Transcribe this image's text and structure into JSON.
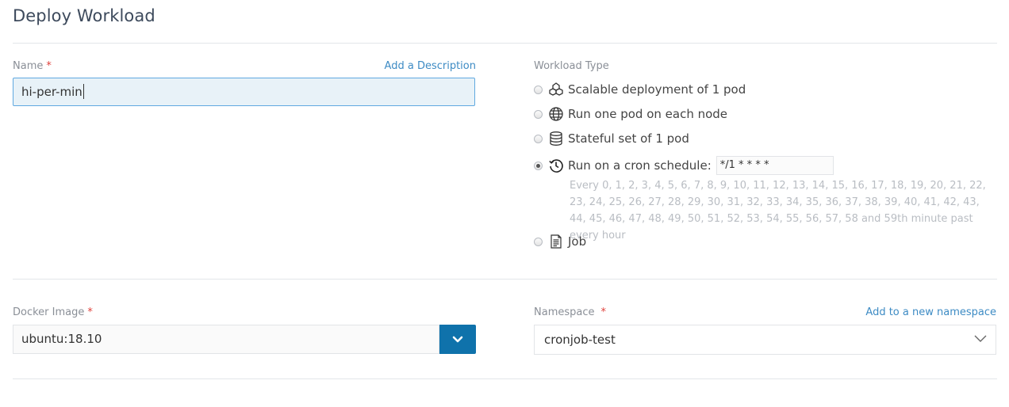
{
  "page": {
    "title": "Deploy Workload"
  },
  "name_field": {
    "label": "Name",
    "required_mark": "*",
    "value": "hi-per-min",
    "add_description_link": "Add a Description"
  },
  "workload_type": {
    "label": "Workload Type",
    "options": [
      {
        "label": "Scalable deployment of 1 pod",
        "icon": "scalable-deployment-icon",
        "selected": false
      },
      {
        "label": "Run one pod on each node",
        "icon": "globe-icon",
        "selected": false
      },
      {
        "label": "Stateful set of 1 pod",
        "icon": "database-icon",
        "selected": false
      },
      {
        "label": "Run on a cron schedule:",
        "icon": "clock-history-icon",
        "selected": true
      },
      {
        "label": "Job",
        "icon": "document-icon",
        "selected": false
      }
    ],
    "cron_value": "*/1 * * * *",
    "cron_help": "Every 0, 1, 2, 3, 4, 5, 6, 7, 8, 9, 10, 11, 12, 13, 14, 15, 16, 17, 18, 19, 20, 21, 22, 23, 24, 25, 26, 27, 28, 29, 30, 31, 32, 33, 34, 35, 36, 37, 38, 39, 40, 41, 42, 43, 44, 45, 46, 47, 48, 49, 50, 51, 52, 53, 54, 55, 56, 57, 58 and 59th minute past every hour"
  },
  "docker_image": {
    "label": "Docker Image",
    "required_mark": "*",
    "value": "ubuntu:18.10",
    "dropdown_icon": "chevron-down-icon"
  },
  "namespace": {
    "label": "Namespace",
    "required_mark": "*",
    "value": "cronjob-test",
    "add_link": "Add to a new namespace"
  },
  "colors": {
    "accent": "#0f72ab",
    "link": "#3d8bc4",
    "required": "#e0423c",
    "input_focus_bg": "#e8f2f8",
    "input_focus_border": "#60a9e0"
  }
}
